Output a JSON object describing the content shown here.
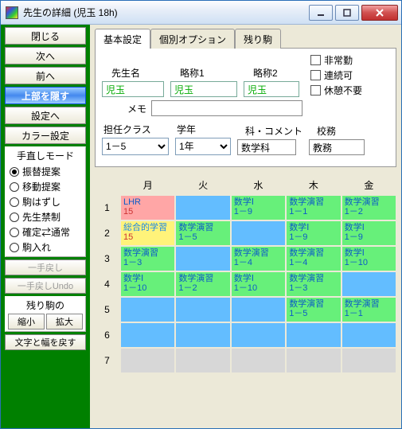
{
  "window": {
    "title": "先生の詳細 (児玉 18h)"
  },
  "sidebar": {
    "buttons": [
      "閉じる",
      "次へ",
      "前へ",
      "上部を隠す",
      "設定へ",
      "カラー設定"
    ],
    "selectedIndex": 3,
    "modePanel": {
      "title": "手直しモード",
      "options": [
        "振替提案",
        "移動提案",
        "駒はずし",
        "先生禁制",
        "確定⇄通常",
        "駒入れ"
      ],
      "checked": 0
    },
    "undo1": "一手戻し",
    "undo2": "一手戻しUndo",
    "remain": {
      "title": "残り駒の",
      "btn1": "縮小",
      "btn2": "拡大"
    },
    "reset": "文字と幅を戻す"
  },
  "tabs": {
    "items": [
      "基本設定",
      "個別オプション",
      "残り駒"
    ],
    "active": 0
  },
  "form": {
    "nameLabel": "先生名",
    "abbr1Label": "略称1",
    "abbr2Label": "略称2",
    "name": "児玉",
    "abbr1": "児玉",
    "abbr2": "児玉",
    "memoLabel": "メモ",
    "memo": "",
    "chk1": "非常勤",
    "chk2": "連続可",
    "chk3": "休憩不要",
    "classLabel": "担任クラス",
    "class": "1－5",
    "gradeLabel": "学年",
    "grade": "1年",
    "subjLabel": "科・コメント",
    "subj": "数学科",
    "dutyLabel": "校務",
    "duty": "教務"
  },
  "schedule": {
    "days": [
      "月",
      "火",
      "水",
      "木",
      "金"
    ],
    "periods": [
      "1",
      "2",
      "3",
      "4",
      "5",
      "6",
      "7"
    ],
    "cells": [
      [
        {
          "t": "LHR",
          "s": "15",
          "c": "pink"
        },
        {
          "c": "blue"
        },
        {
          "t": "数学Ⅰ",
          "s": "1－9",
          "c": "green"
        },
        {
          "t": "数学演習",
          "s": "1－1",
          "c": "green"
        },
        {
          "t": "数学演習",
          "s": "1－2",
          "c": "green"
        }
      ],
      [
        {
          "t": "総合的学習",
          "s": "15",
          "c": "yellow"
        },
        {
          "t": "数学演習",
          "s": "1－5",
          "c": "green"
        },
        {
          "c": "blue"
        },
        {
          "t": "数学Ⅰ",
          "s": "1－9",
          "c": "green"
        },
        {
          "t": "数学Ⅰ",
          "s": "1－9",
          "c": "green"
        }
      ],
      [
        {
          "t": "数学演習",
          "s": "1－3",
          "c": "green"
        },
        {
          "c": "blue"
        },
        {
          "t": "数学演習",
          "s": "1－4",
          "c": "green"
        },
        {
          "t": "数学演習",
          "s": "1－4",
          "c": "green"
        },
        {
          "t": "数学Ⅰ",
          "s": "1－10",
          "c": "green"
        }
      ],
      [
        {
          "t": "数学Ⅰ",
          "s": "1－10",
          "c": "green"
        },
        {
          "t": "数学演習",
          "s": "1－2",
          "c": "green"
        },
        {
          "t": "数学Ⅰ",
          "s": "1－10",
          "c": "green"
        },
        {
          "t": "数学演習",
          "s": "1－3",
          "c": "green"
        },
        {
          "c": "blue"
        }
      ],
      [
        {
          "c": "blue"
        },
        {
          "c": "blue"
        },
        {
          "c": "blue"
        },
        {
          "t": "数学演習",
          "s": "1－5",
          "c": "green"
        },
        {
          "t": "数学演習",
          "s": "1－1",
          "c": "green"
        }
      ],
      [
        {
          "c": "blue"
        },
        {
          "c": "blue"
        },
        {
          "c": "blue"
        },
        {
          "c": "blue"
        },
        {
          "c": "blue"
        }
      ],
      [
        {
          "c": "gray"
        },
        {
          "c": "gray"
        },
        {
          "c": "gray"
        },
        {
          "c": "gray"
        },
        {
          "c": "gray"
        }
      ]
    ]
  }
}
